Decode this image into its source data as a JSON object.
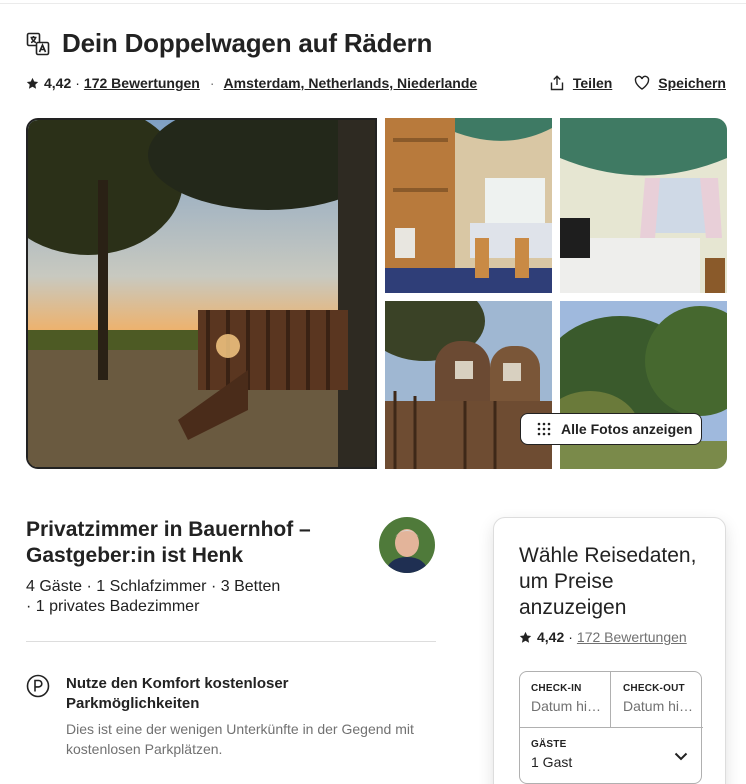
{
  "header": {
    "title": "Dein Doppelwagen auf Rädern",
    "rating": "4,42",
    "rating_sep": "·",
    "reviews_link": "172 Bewertungen",
    "separator": "·",
    "location_link": "Amsterdam, Netherlands, Niederlande",
    "share_label": "Teilen",
    "save_label": "Speichern"
  },
  "gallery": {
    "show_all_label": "Alle Fotos anzeigen"
  },
  "listing": {
    "title": "Privatzimmer in Bauernhof – Gastgeber:in ist Henk",
    "details_line1": "4 Gäste · 1 Schlafzimmer · 3 Betten",
    "details_line2": " · 1 privates Badezimmer"
  },
  "amenity": {
    "title": "Nutze den Komfort kostenloser Parkmöglichkeiten",
    "description": "Dies ist eine der wenigen Unterkünfte in der Gegend mit kostenlosen Parkplätzen."
  },
  "booking": {
    "title": "Wähle Reisedaten, um Preise anzuzeigen",
    "rating": "4,42",
    "rating_sep": "·",
    "reviews_link": "172 Bewertungen",
    "checkin_label": "CHECK-IN",
    "checkin_placeholder": "Datum hinzufügen",
    "checkout_label": "CHECK-OUT",
    "checkout_placeholder": "Datum hinzufügen",
    "guests_label": "GÄSTE",
    "guests_value": "1 Gast"
  },
  "colors": {
    "text": "#222222",
    "secondary": "#717171",
    "border": "#dddddd"
  }
}
